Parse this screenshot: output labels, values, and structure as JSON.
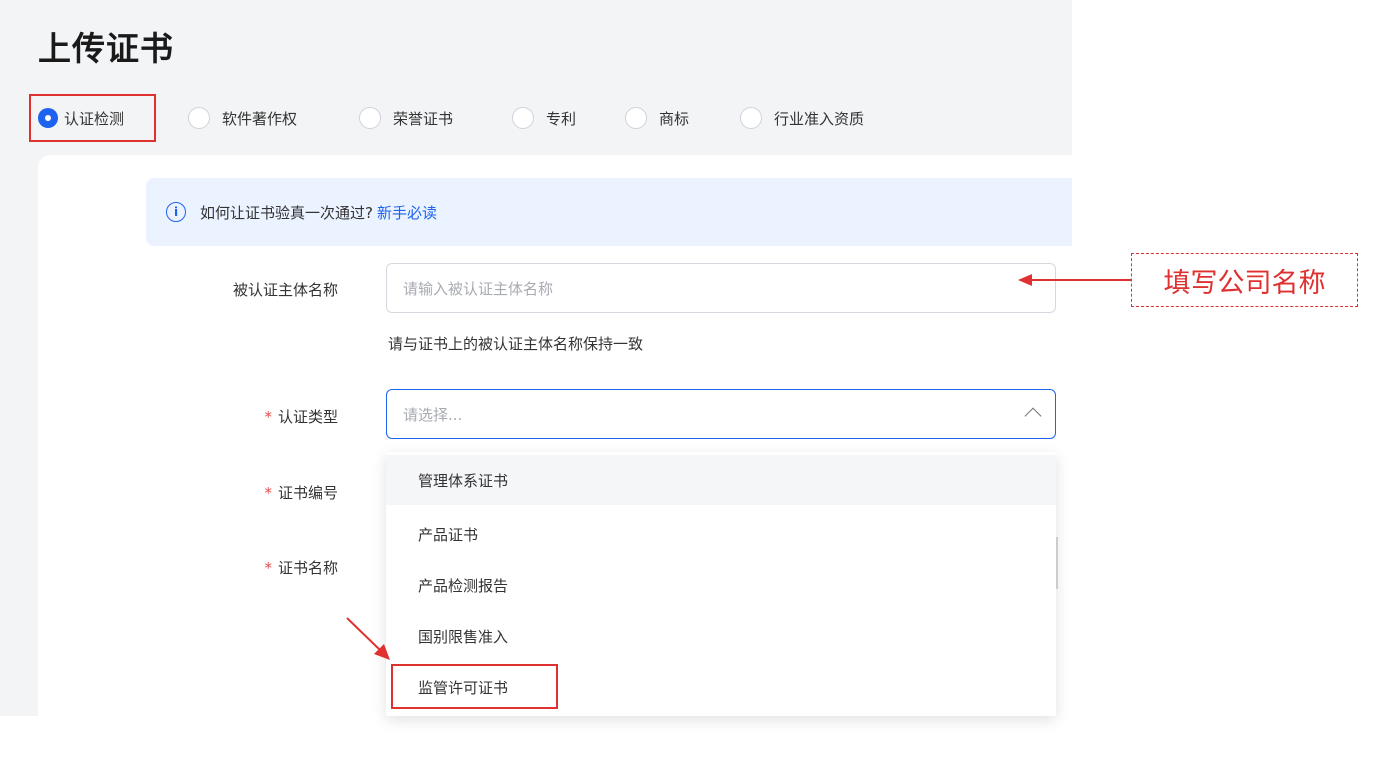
{
  "page": {
    "title": "上传证书"
  },
  "tabs": [
    {
      "label": "认证检测",
      "selected": true
    },
    {
      "label": "软件著作权",
      "selected": false
    },
    {
      "label": "荣誉证书",
      "selected": false
    },
    {
      "label": "专利",
      "selected": false
    },
    {
      "label": "商标",
      "selected": false
    },
    {
      "label": "行业准入资质",
      "selected": false
    }
  ],
  "notice": {
    "text": "如何让证书验真一次通过?",
    "link": "新手必读"
  },
  "form": {
    "subject": {
      "label": "被认证主体名称",
      "placeholder": "请输入被认证主体名称",
      "hint": "请与证书上的被认证主体名称保持一致"
    },
    "cert_type": {
      "required_mark": "*",
      "label": "认证类型",
      "placeholder": "请选择..."
    },
    "cert_no": {
      "required_mark": "*",
      "label": "证书编号"
    },
    "cert_name": {
      "required_mark": "*",
      "label": "证书名称"
    }
  },
  "dropdown": {
    "options": [
      "管理体系证书",
      "产品证书",
      "产品检测报告",
      "国别限售准入",
      "监管许可证书"
    ],
    "hovered_index": 0,
    "highlighted_index": 4
  },
  "annotation": {
    "callout": "填写公司名称"
  },
  "colors": {
    "accent": "#1e62f0",
    "annotation": "#e03131",
    "required": "#e34d4d"
  }
}
